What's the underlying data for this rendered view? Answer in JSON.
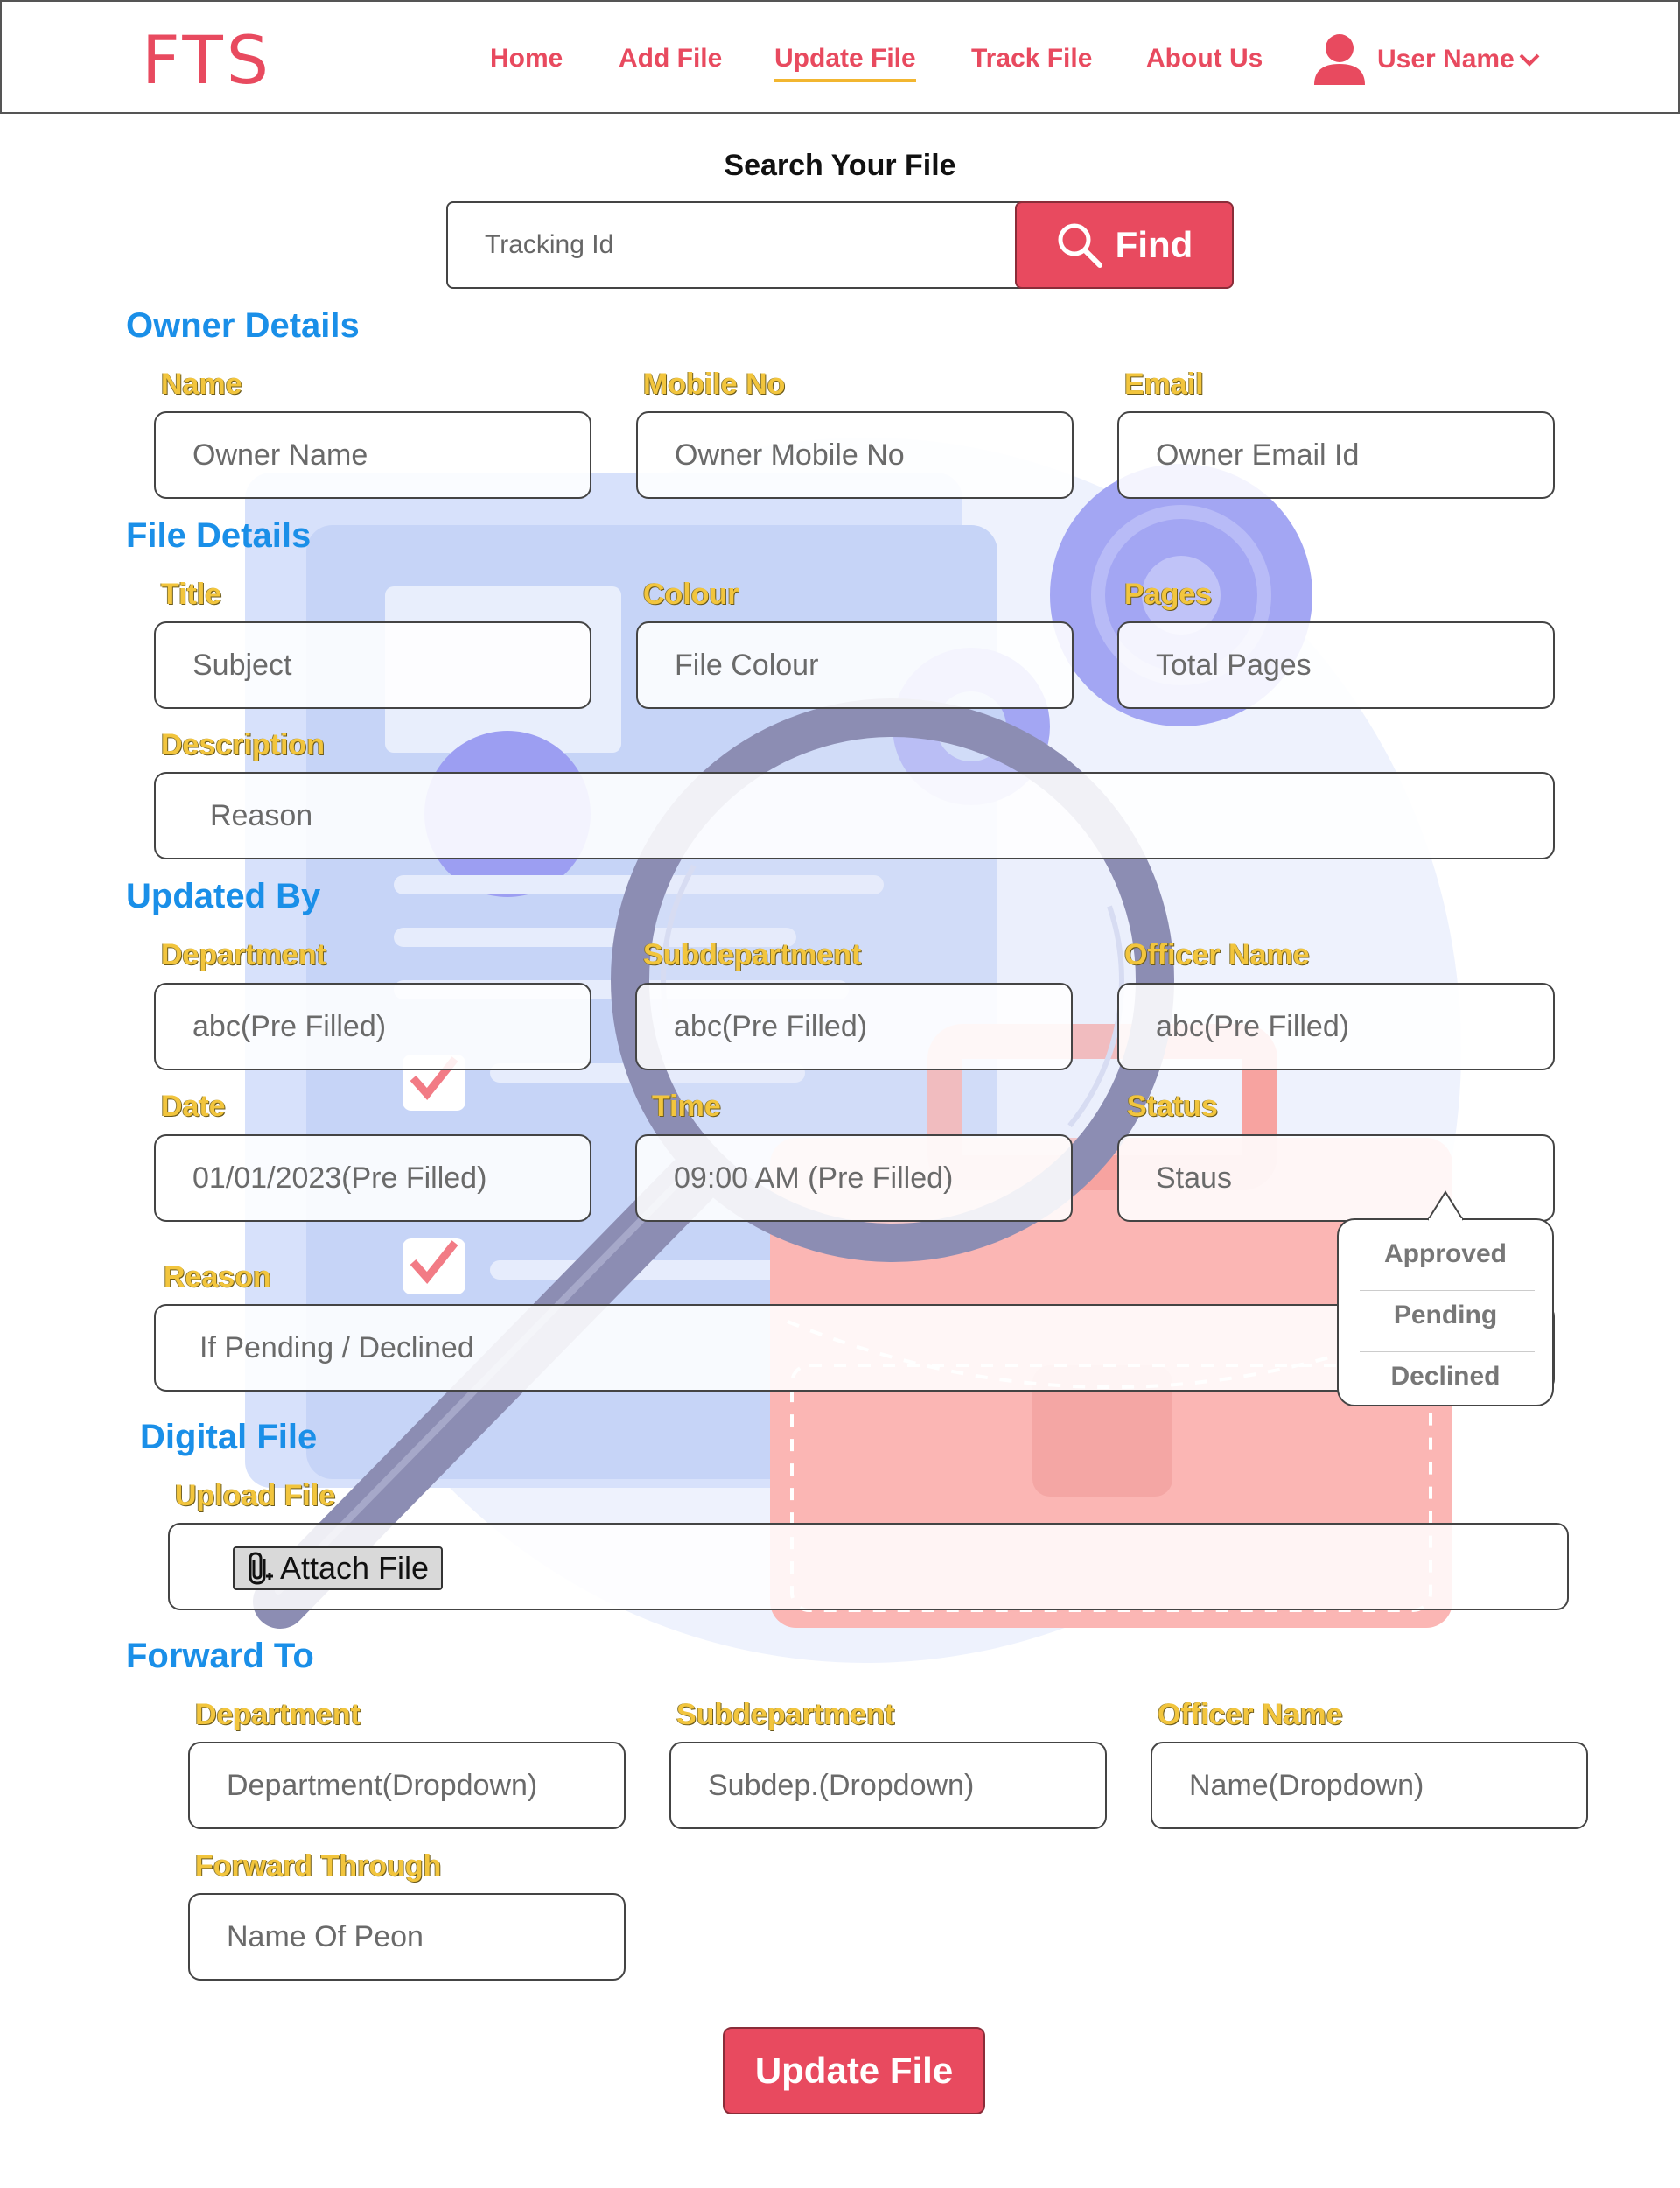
{
  "header": {
    "logo": "FTS",
    "nav": [
      "Home",
      "Add File",
      "Update File",
      "Track File",
      "About Us"
    ],
    "active_nav": "Update File",
    "user_name": "User Name"
  },
  "search": {
    "title": "Search Your File",
    "placeholder": "Tracking Id",
    "button_label": "Find"
  },
  "owner_details": {
    "title": "Owner Details",
    "name_label": "Name",
    "name_placeholder": "Owner Name",
    "mobile_label": "Mobile No",
    "mobile_placeholder": "Owner Mobile No",
    "email_label": "Email",
    "email_placeholder": "Owner Email Id"
  },
  "file_details": {
    "title": "File Details",
    "title_label": "Title",
    "title_placeholder": "Subject",
    "colour_label": "Colour",
    "colour_placeholder": "File Colour",
    "pages_label": "Pages",
    "pages_placeholder": "Total Pages",
    "description_label": "Description",
    "description_placeholder": "Reason"
  },
  "updated_by": {
    "title": "Updated By",
    "department_label": "Department",
    "department_value": "abc(Pre Filled)",
    "subdepartment_label": "Subdepartment",
    "subdepartment_value": "abc(Pre Filled)",
    "officer_label": "Officer Name",
    "officer_value": "abc(Pre Filled)",
    "date_label": "Date",
    "date_value": "01/01/2023(Pre Filled)",
    "time_label": "Time",
    "time_value": "09:00 AM (Pre Filled)",
    "status_label": "Status",
    "status_placeholder": "Staus",
    "status_options": [
      "Approved",
      "Pending",
      "Declined"
    ],
    "reason_label": "Reason",
    "reason_placeholder": "If Pending / Declined"
  },
  "digital_file": {
    "title": "Digital File",
    "upload_label": "Upload File",
    "attach_label": "Attach File"
  },
  "forward_to": {
    "title": "Forward To",
    "department_label": "Department",
    "department_placeholder": "Department(Dropdown)",
    "subdepartment_label": "Subdepartment",
    "subdepartment_placeholder": "Subdep.(Dropdown)",
    "officer_label": "Officer Name",
    "officer_placeholder": "Name(Dropdown)",
    "through_label": "Forward Through",
    "through_placeholder": "Name Of Peon"
  },
  "submit_label": "Update File",
  "colors": {
    "brand": "#e84a5f",
    "section_title": "#1a8fe8",
    "field_label": "#f2c53d",
    "nav_underline": "#f2b630"
  },
  "icons": {
    "search_button": "search-icon",
    "user": "user-icon",
    "user_menu": "chevron-down-icon",
    "attach": "paperclip-icon"
  }
}
